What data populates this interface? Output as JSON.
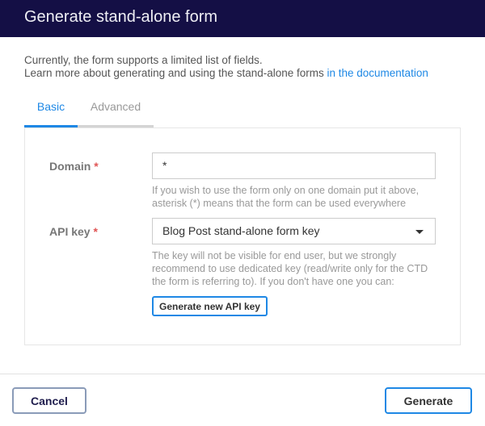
{
  "header": {
    "title": "Generate stand-alone form"
  },
  "intro": {
    "line1": "Currently, the form supports a limited list of fields.",
    "line2": "Learn more about generating and using the stand-alone forms ",
    "link": "in the documentation"
  },
  "tabs": [
    {
      "label": "Basic",
      "active": true
    },
    {
      "label": "Advanced",
      "active": false
    }
  ],
  "form": {
    "domain": {
      "label": "Domain",
      "required": "*",
      "value": "*",
      "help1": "If you wish to use the form only on one domain put it above,",
      "help2": "asterisk (*) means that the form can be used everywhere"
    },
    "api_key": {
      "label": "API key",
      "required": "*",
      "value": "Blog Post stand-alone form key",
      "help1": "The key will not be visible for end user, but we strongly",
      "help2": "recommend to use dedicated key (read/write only for the CTD",
      "help3": "the form is referring to). If you don't have one you can:",
      "button": "Generate new API key"
    }
  },
  "footer": {
    "cancel": "Cancel",
    "generate": "Generate"
  },
  "colors": {
    "header_bg": "#140f45",
    "accent": "#1e88e5",
    "required": "#e05555"
  }
}
